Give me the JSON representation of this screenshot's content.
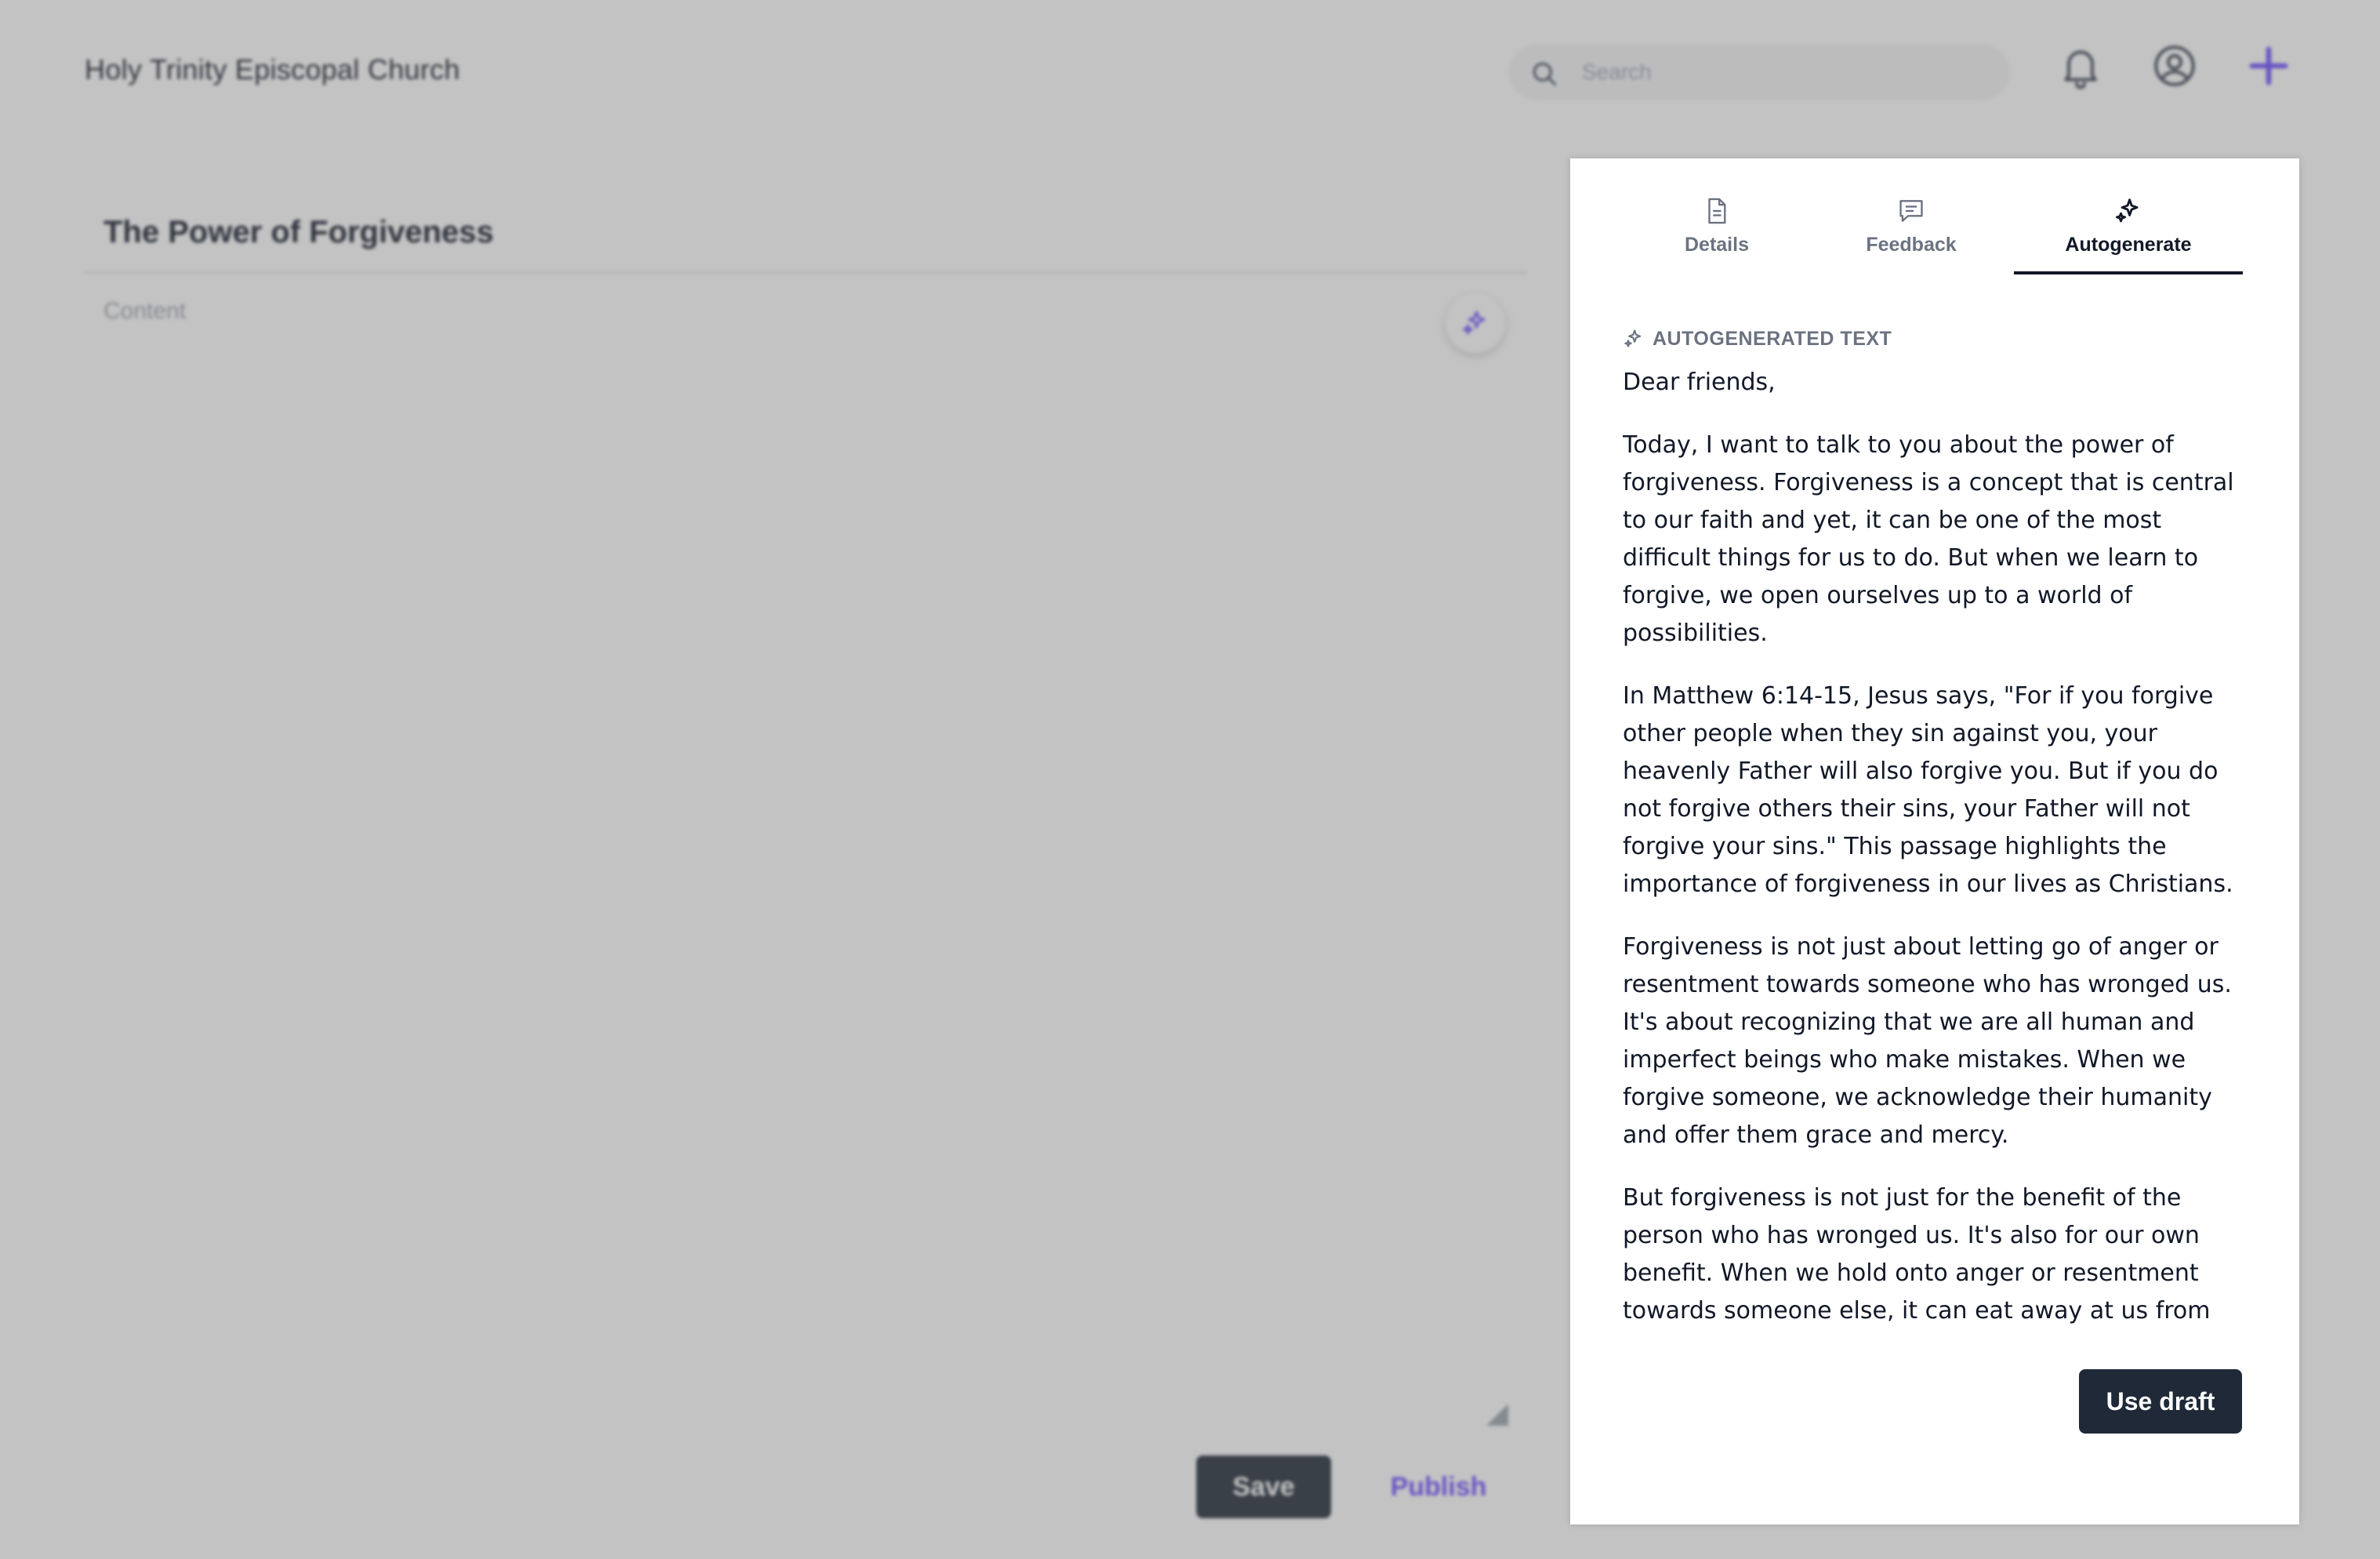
{
  "header": {
    "church_name": "Holy Trinity Episcopal Church",
    "search_placeholder": "Search",
    "icons": [
      "search-icon",
      "bell-icon",
      "user-icon",
      "plus-icon"
    ],
    "accent_color": "#6d4aff"
  },
  "editor": {
    "title": "The Power of Forgiveness",
    "content_placeholder": "Content",
    "save_label": "Save",
    "publish_label": "Publish"
  },
  "panel": {
    "tabs": [
      {
        "label": "Details",
        "icon": "document-icon"
      },
      {
        "label": "Feedback",
        "icon": "comment-icon"
      },
      {
        "label": "Autogenerate",
        "icon": "sparkles-icon",
        "active": true
      }
    ],
    "section_label": "AUTOGENERATED TEXT",
    "paragraphs": [
      "Dear friends,",
      "Today, I want to talk to you about the power of forgiveness. Forgiveness is a concept that is central to our faith and yet, it can be one of the most difficult things for us to do. But when we learn to forgive, we open ourselves up to a world of possibilities.",
      "In Matthew 6:14-15, Jesus says, \"For if you forgive other people when they sin against you, your heavenly Father will also forgive you. But if you do not forgive others their sins, your Father will not forgive your sins.\" This passage highlights the importance of forgiveness in our lives as Christians.",
      "Forgiveness is not just about letting go of anger or resentment towards someone who has wronged us. It's about recognizing that we are all human and imperfect beings who make mistakes. When we forgive someone, we acknowledge their humanity and offer them grace and mercy.",
      "But forgiveness is not just for the benefit of the person who has wronged us. It's also for our own benefit. When we hold onto anger or resentment towards someone else, it can eat away at us from"
    ],
    "use_draft_label": "Use draft"
  }
}
